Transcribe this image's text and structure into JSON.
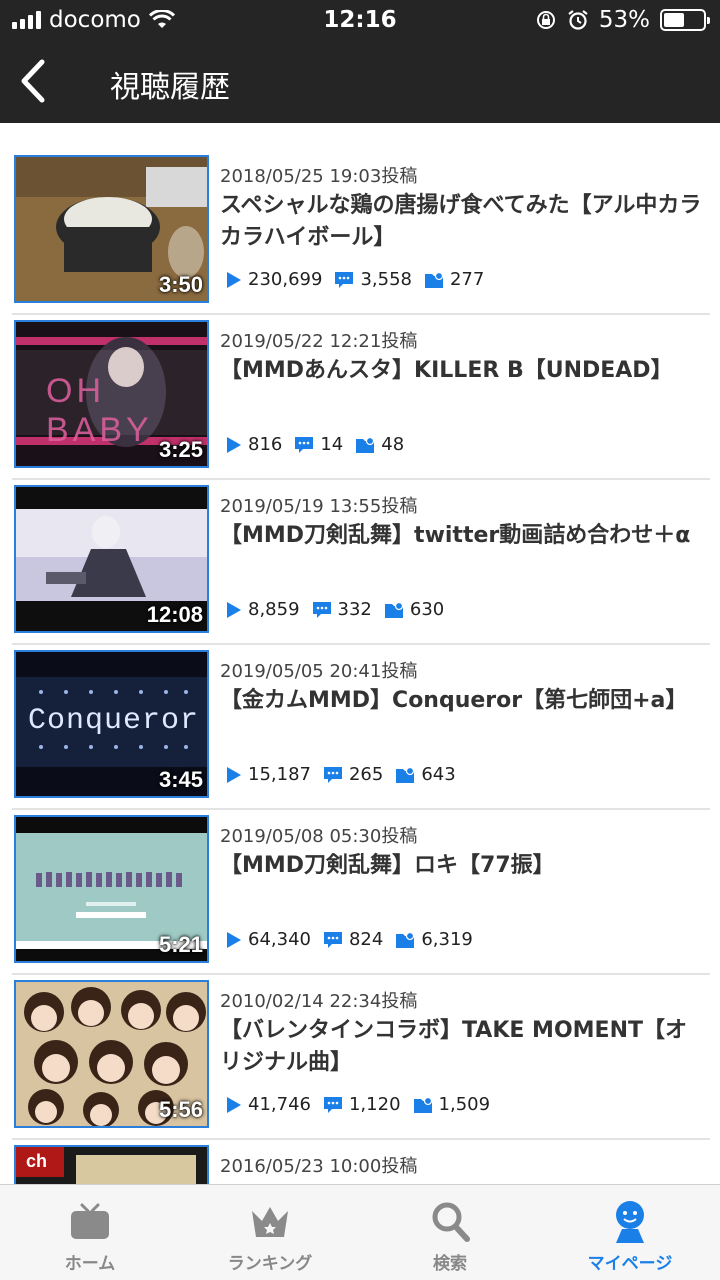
{
  "status": {
    "carrier": "docomo",
    "time": "12:16",
    "battery_percent": "53%",
    "battery_level": 0.53
  },
  "header": {
    "title": "視聴履歴",
    "back_icon": "chevron-left-icon"
  },
  "videos": [
    {
      "date": "2018/05/25 19:03投稿",
      "title": "スペシャルな鶏の唐揚げ食べてみた【アル中カラカラハイボール】",
      "duration": "3:50",
      "views": "230,699",
      "comments": "3,558",
      "mylists": "277"
    },
    {
      "date": "2019/05/22 12:21投稿",
      "title": "【MMDあんスタ】KILLER B【UNDEAD】",
      "duration": "3:25",
      "views": "816",
      "comments": "14",
      "mylists": "48"
    },
    {
      "date": "2019/05/19 13:55投稿",
      "title": "【MMD刀剣乱舞】twitter動画詰め合わせ＋α",
      "duration": "12:08",
      "views": "8,859",
      "comments": "332",
      "mylists": "630"
    },
    {
      "date": "2019/05/05 20:41投稿",
      "title": "【金カムMMD】Conqueror【第七師団+a】",
      "duration": "3:45",
      "views": "15,187",
      "comments": "265",
      "mylists": "643"
    },
    {
      "date": "2019/05/08 05:30投稿",
      "title": "【MMD刀剣乱舞】ロキ【77振】",
      "duration": "5:21",
      "views": "64,340",
      "comments": "824",
      "mylists": "6,319"
    },
    {
      "date": "2010/02/14 22:34投稿",
      "title": "【バレンタインコラボ】TAKE MOMENT【オリジナル曲】",
      "duration": "5:56",
      "views": "41,746",
      "comments": "1,120",
      "mylists": "1,509"
    },
    {
      "date": "2016/05/23 10:00投稿",
      "title": "",
      "duration": "",
      "views": "",
      "comments": "",
      "mylists": ""
    }
  ],
  "thumb_texts": {
    "oh_baby": "OH BABY",
    "conqueror": "Conqueror",
    "ch": "ch"
  },
  "tabs": [
    {
      "label": "ホーム",
      "icon": "tv-icon"
    },
    {
      "label": "ランキング",
      "icon": "crown-icon"
    },
    {
      "label": "検索",
      "icon": "search-icon"
    },
    {
      "label": "マイページ",
      "icon": "user-icon"
    }
  ],
  "colors": {
    "accent": "#1a80e8",
    "header_bg": "#252525",
    "thumb_border": "#2a7fdc"
  }
}
